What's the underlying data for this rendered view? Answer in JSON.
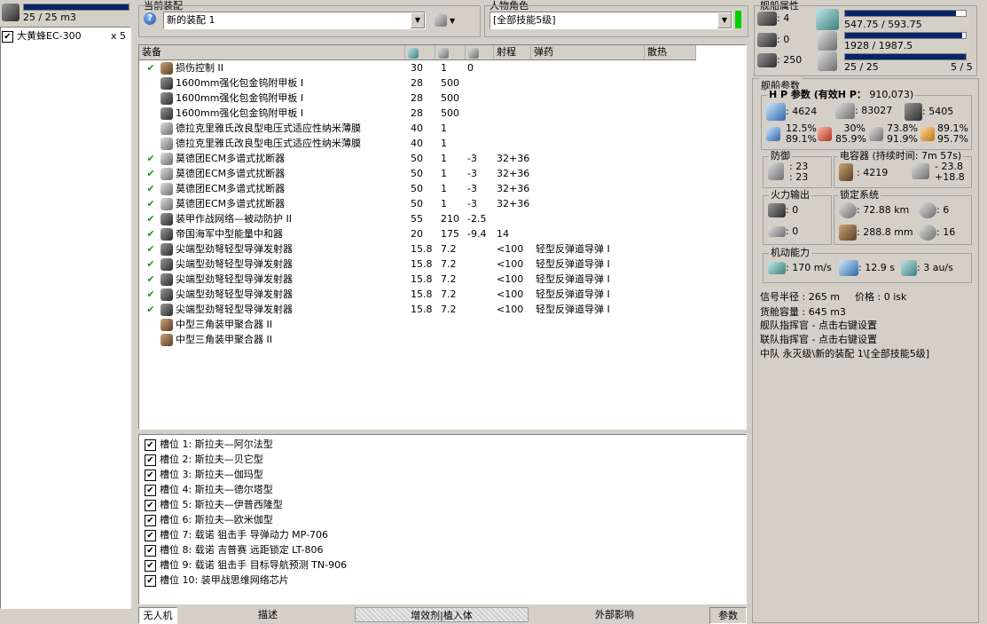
{
  "left_panel": {
    "cargo_text": "25 / 25 m3",
    "cargo_fill": 1.0,
    "drone": {
      "name": "大黄蜂EC-300",
      "count": "x 5",
      "checked": true
    }
  },
  "fitting": {
    "label": "当前装配",
    "value": "新的装配 1",
    "help_icon": "question-icon"
  },
  "character": {
    "label": "人物角色",
    "value": "[全部技能5级]",
    "status_color": "#00d000"
  },
  "module_table": {
    "headers": [
      "装备",
      "",
      "",
      "",
      "射程",
      "弹药",
      "散热"
    ],
    "rows": [
      {
        "green": true,
        "icon": "ico-brown",
        "name": "损伤控制 II",
        "c1": "30",
        "c2": "1",
        "c3": "0",
        "range": "",
        "ammo": ""
      },
      {
        "green": false,
        "icon": "ico-dark",
        "name": "1600mm强化包金钨附甲板 I",
        "c1": "28",
        "c2": "500",
        "c3": "",
        "range": "",
        "ammo": ""
      },
      {
        "green": false,
        "icon": "ico-dark",
        "name": "1600mm强化包金钨附甲板 I",
        "c1": "28",
        "c2": "500",
        "c3": "",
        "range": "",
        "ammo": ""
      },
      {
        "green": false,
        "icon": "ico-dark",
        "name": "1600mm强化包金钨附甲板 I",
        "c1": "28",
        "c2": "500",
        "c3": "",
        "range": "",
        "ammo": ""
      },
      {
        "green": false,
        "icon": "ico-gray",
        "name": "德拉克里雅氏改良型电压式适应性纳米薄膜",
        "c1": "40",
        "c2": "1",
        "c3": "",
        "range": "",
        "ammo": ""
      },
      {
        "green": false,
        "icon": "ico-gray",
        "name": "德拉克里雅氏改良型电压式适应性纳米薄膜",
        "c1": "40",
        "c2": "1",
        "c3": "",
        "range": "",
        "ammo": ""
      },
      {
        "green": true,
        "icon": "ico-gray",
        "name": "莫德团ECM多谱式扰断器",
        "c1": "50",
        "c2": "1",
        "c3": "-3",
        "range": "32+36",
        "ammo": ""
      },
      {
        "green": true,
        "icon": "ico-gray",
        "name": "莫德团ECM多谱式扰断器",
        "c1": "50",
        "c2": "1",
        "c3": "-3",
        "range": "32+36",
        "ammo": ""
      },
      {
        "green": true,
        "icon": "ico-gray",
        "name": "莫德团ECM多谱式扰断器",
        "c1": "50",
        "c2": "1",
        "c3": "-3",
        "range": "32+36",
        "ammo": ""
      },
      {
        "green": true,
        "icon": "ico-gray",
        "name": "莫德团ECM多谱式扰断器",
        "c1": "50",
        "c2": "1",
        "c3": "-3",
        "range": "32+36",
        "ammo": ""
      },
      {
        "green": true,
        "icon": "ico-dark",
        "name": "装甲作战网络—被动防护 II",
        "c1": "55",
        "c2": "210",
        "c3": "-2.5",
        "range": "",
        "ammo": ""
      },
      {
        "green": true,
        "icon": "ico-dark",
        "name": "帝国海军中型能量中和器",
        "c1": "20",
        "c2": "175",
        "c3": "-9.4",
        "range": "14",
        "ammo": ""
      },
      {
        "green": true,
        "icon": "ico-dark",
        "name": "尖端型劲弩轻型导弹发射器",
        "c1": "15.8",
        "c2": "7.2",
        "c3": "",
        "range": "<100",
        "ammo": "轻型反弹道导弹 I"
      },
      {
        "green": true,
        "icon": "ico-dark",
        "name": "尖端型劲弩轻型导弹发射器",
        "c1": "15.8",
        "c2": "7.2",
        "c3": "",
        "range": "<100",
        "ammo": "轻型反弹道导弹 I"
      },
      {
        "green": true,
        "icon": "ico-dark",
        "name": "尖端型劲弩轻型导弹发射器",
        "c1": "15.8",
        "c2": "7.2",
        "c3": "",
        "range": "<100",
        "ammo": "轻型反弹道导弹 I"
      },
      {
        "green": true,
        "icon": "ico-dark",
        "name": "尖端型劲弩轻型导弹发射器",
        "c1": "15.8",
        "c2": "7.2",
        "c3": "",
        "range": "<100",
        "ammo": "轻型反弹道导弹 I"
      },
      {
        "green": true,
        "icon": "ico-dark",
        "name": "尖端型劲弩轻型导弹发射器",
        "c1": "15.8",
        "c2": "7.2",
        "c3": "",
        "range": "<100",
        "ammo": "轻型反弹道导弹 I"
      },
      {
        "green": false,
        "icon": "ico-brown",
        "name": "中型三角装甲聚合器 II",
        "c1": "",
        "c2": "",
        "c3": "",
        "range": "",
        "ammo": ""
      },
      {
        "green": false,
        "icon": "ico-brown",
        "name": "中型三角装甲聚合器 II",
        "c1": "",
        "c2": "",
        "c3": "",
        "range": "",
        "ammo": ""
      }
    ]
  },
  "implants": [
    "槽位 1: 斯拉夫—阿尔法型",
    "槽位 2: 斯拉夫—贝它型",
    "槽位 3: 斯拉夫—伽玛型",
    "槽位 4: 斯拉夫—德尔塔型",
    "槽位 5: 斯拉夫—伊普西隆型",
    "槽位 6: 斯拉夫—欧米伽型",
    "槽位 7: 载诺 狙击手 导弹动力 MP-706",
    "槽位 8: 载诺 吉普赛 远距锁定 LT-806",
    "槽位 9: 载诺 狙击手 目标导航预测 TN-906",
    "槽位 10: 装甲战思维网络芯片"
  ],
  "bottom_tabs": [
    "无人机",
    "描述",
    "增效剂|植入体",
    "外部影响",
    "参数"
  ],
  "ship_attributes": {
    "title": "舰船属性",
    "turret": ": 4",
    "launcher": ": 0",
    "calibration": ": 250",
    "cpu_text": "547.75 / 593.75",
    "cpu_fill": 0.92,
    "pg_text": "1928 / 1987.5",
    "pg_fill": 0.97,
    "drone_bay_text": "25 / 25",
    "drone_count": "5 / 5",
    "drone_fill": 1.0
  },
  "ship_params": {
    "title": "舰船参数",
    "hp_title": "H P 参数 (有效H P：",
    "ehp": "910,073)",
    "shield": ": 4624",
    "armor": ": 83027",
    "structure": ": 5405",
    "res": [
      {
        "top": "12.5%",
        "bottom": "89.1%"
      },
      {
        "top": "30%",
        "bottom": "85.9%"
      },
      {
        "top": "73.8%",
        "bottom": "91.9%"
      },
      {
        "top": "89.1%",
        "bottom": "95.7%"
      }
    ],
    "defense_title": "防御",
    "defense_1": ": 23",
    "defense_2": ": 23",
    "cap_title": "电容器 (持续时间: 7m 57s)",
    "cap_amount": ": 4219",
    "cap_delta_1": "- 23.8",
    "cap_delta_2": "+18.8",
    "fire_title": "火力输出",
    "fire_1": ": 0",
    "fire_2": ": 0",
    "lock_title": "锁定系统",
    "lock_range": ": 72.88 km",
    "lock_targets": ": 6",
    "scan_res": ": 288.8 mm",
    "sensor": ": 16",
    "mob_title": "机动能力",
    "speed": ": 170 m/s",
    "align": ": 12.9 s",
    "warp": ": 3 au/s",
    "sig_radius": "信号半径 : 265 m",
    "price": "价格 : 0 isk",
    "cargo": "货舱容量 : 645 m3",
    "fleet_cmd": "舰队指挥官 - 点击右键设置",
    "wing_cmd": "联队指挥官 - 点击右键设置",
    "squad": "中队 永灭级\\新的装配 1\\[全部技能5级]"
  }
}
